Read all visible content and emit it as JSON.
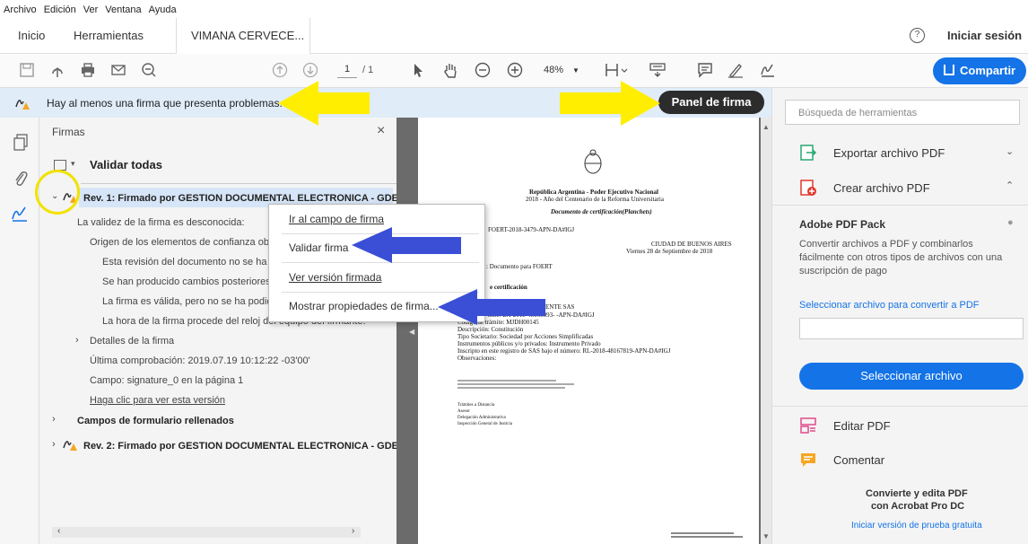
{
  "menubar": {
    "items": [
      "Archivo",
      "Edición",
      "Ver",
      "Ventana",
      "Ayuda"
    ]
  },
  "tabs": {
    "home": "Inicio",
    "tools": "Herramientas",
    "doc": "VIMANA CERVECE...",
    "close": "×",
    "signin": "Iniciar sesión",
    "help": "?"
  },
  "toolbar": {
    "page_current": "1",
    "page_total": "/ 1",
    "zoom": "48%",
    "share": "Compartir"
  },
  "message": {
    "text": "Hay al menos una firma que presenta problemas.",
    "panel_button": "Panel de firma"
  },
  "signatures": {
    "title": "Firmas",
    "close": "×",
    "validate_all": "Validar todas",
    "rev1_title": "Rev. 1: Firmado por GESTION DOCUMENTAL ELECTRONICA - GDE",
    "lines": [
      "La validez de la firma es desconocida:",
      "Origen de los elementos de confianza obteni",
      "Esta revisión del documento no se ha mod",
      "Se han producido cambios posteriores en",
      "La firma es válida, pero no se ha podido c",
      "La hora de la firma procede del reloj del equipo del firmante."
    ],
    "details": "Detalles de la firma",
    "last_check": "Última comprobación: 2019.07.19 10:12:22 -03'00'",
    "field": "Campo: signature_0 en la página 1",
    "view_link": "Haga clic para ver esta versión",
    "form_fields": "Campos de formulario rellenados",
    "rev2_title": "Rev. 2: Firmado por GESTION DOCUMENTAL ELECTRONICA - GDE"
  },
  "context_menu": {
    "go_field": "Ir al campo de firma",
    "validate": "Validar firma",
    "view_signed": "Ver versión firmada",
    "show_props": "Mostrar propiedades de firma..."
  },
  "document": {
    "header1": "República Argentina - Poder Ejecutivo Nacional",
    "header2": "2018 - Año del Centenario de la Reforma Universitaria",
    "doc_type": "Documento de certificación(Planchets)",
    "number": "FOERT-2018-3479-APN-DA#IGJ",
    "city": "CIUDAD DE BUENOS AIRES",
    "date": "Viernes 28 de Septiembre de 2018",
    "ref": ": Documento para FOERT",
    "cert": "e certificación",
    "company": "ECERIA INDEPENDIENTE SAS",
    "expediente": "mite: EX-2018-48166093- -APN-DA#IGJ",
    "code": "Código de trámite: MJDH00145",
    "desc": "Descripción: Constitución",
    "type": "Tipo Societario: Sociedad por Acciones Simplificadas",
    "instr": "Instrumentos públicos y/o privados: Instrumento Privado",
    "inscr": "Inscripto en este registro de SAS bajo el número: RL-2018-48167819-APN-DA#IGJ",
    "obs": "Observaciones:",
    "footer1": "Trámites a Distancia",
    "footer2": "Asesor",
    "footer3": "Delegación Administrativa",
    "footer4": "Inspección General de Justicia"
  },
  "right_pane": {
    "search_placeholder": "Búsqueda de herramientas",
    "export": "Exportar archivo PDF",
    "create": "Crear archivo PDF",
    "pack_title": "Adobe PDF Pack",
    "pack_desc1": "Convertir archivos a PDF y combinarlos",
    "pack_desc2": "fácilmente con otros tipos de archivos con una",
    "pack_desc3": "suscripción de pago",
    "select_link": "Seleccionar archivo para convertir a PDF",
    "select_button": "Seleccionar archivo",
    "edit": "Editar PDF",
    "comment": "Comentar",
    "promo1": "Convierte y edita PDF",
    "promo2": "con Acrobat Pro DC",
    "trial": "Iniciar versión de prueba gratuita"
  },
  "colors": {
    "accent": "#1473e6",
    "yellow_arrow": "#ffee00",
    "blue_arrow": "#3a4fd6",
    "message_bg": "#e0ecf8"
  }
}
